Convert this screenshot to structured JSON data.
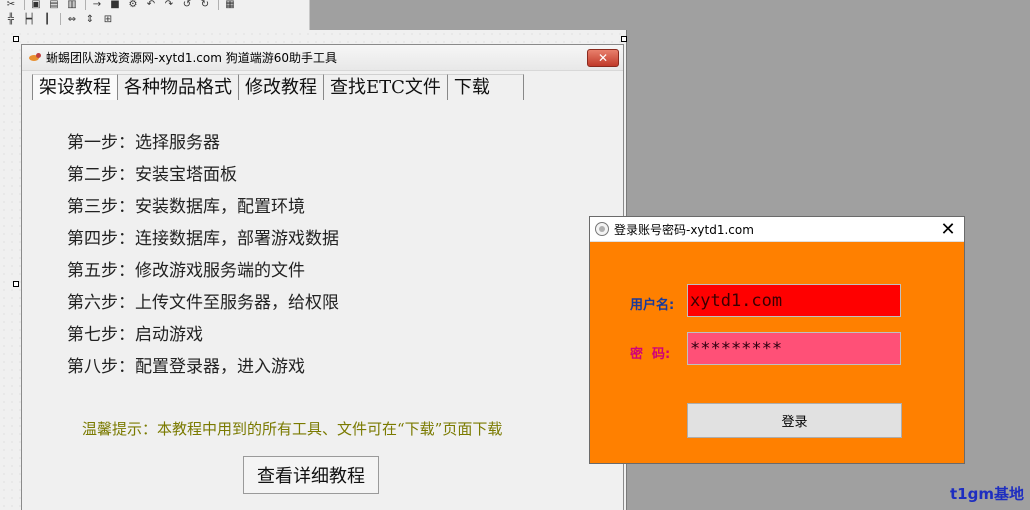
{
  "toolbar": {
    "row1": [
      "✂",
      "▣",
      "▤",
      "▥",
      "→",
      "■",
      "⚙",
      "↶",
      "↷",
      "↺",
      "↻",
      "▦"
    ],
    "row2": [
      "╬",
      "┝┥",
      "┃",
      "⇔",
      "⇕",
      "⊞"
    ]
  },
  "main_window": {
    "title": "蜥蜴团队游戏资源网-xytd1.com 狗道端游60助手工具",
    "close_label": "✕",
    "tabs": [
      {
        "label": "架设教程",
        "active": true
      },
      {
        "label": "各种物品格式",
        "active": false
      },
      {
        "label": "修改教程",
        "active": false
      },
      {
        "label": "查找ETC文件",
        "active": false
      },
      {
        "label": "下载",
        "active": false
      }
    ],
    "steps": [
      "第一步：选择服务器",
      "第二步：安装宝塔面板",
      "第三步：安装数据库，配置环境",
      "第四步：连接数据库，部署游戏数据",
      "第五步：修改游戏服务端的文件",
      "第六步：上传文件至服务器，给权限",
      "第七步：启动游戏",
      "第八步：配置登录器，进入游戏"
    ],
    "tip": "温馨提示：本教程中用到的所有工具、文件可在“下载”页面下载",
    "detail_button": "查看详细教程"
  },
  "login_dialog": {
    "title": "登录账号密码-xytd1.com",
    "close_label": "✕",
    "username_label": "用户名:",
    "username_value": "xytd1.com",
    "password_label": "密  码:",
    "password_value": "*********",
    "login_button": "登录",
    "colors": {
      "background": "#ff8000",
      "username_field": "#ff0000",
      "password_field": "#ff5077"
    }
  },
  "watermark": "t1gm基地"
}
